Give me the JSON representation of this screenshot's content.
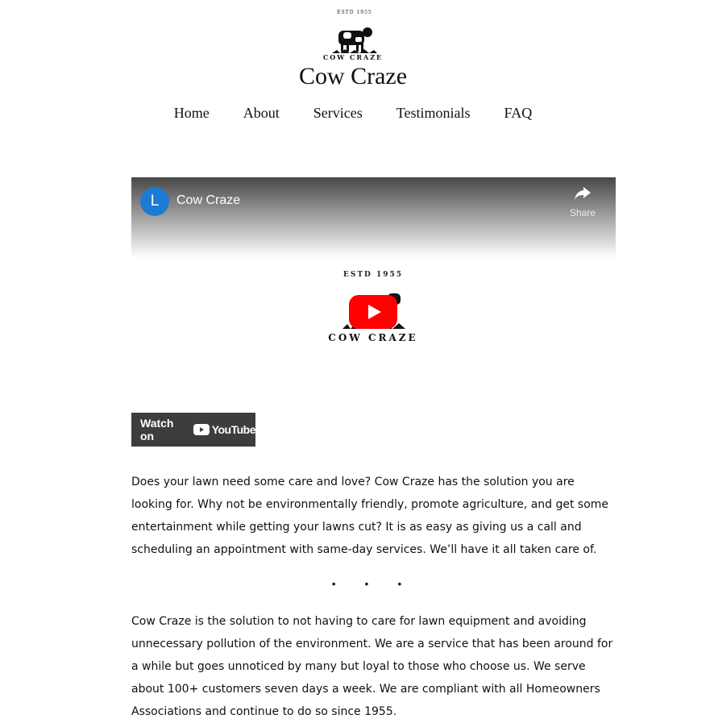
{
  "header": {
    "logo": {
      "estd": "ESTD 1955",
      "word": "COW CRAZE"
    },
    "site_title": "Cow Craze"
  },
  "nav": {
    "items": [
      {
        "label": "Home"
      },
      {
        "label": "About"
      },
      {
        "label": "Services"
      },
      {
        "label": "Testimonials"
      },
      {
        "label": "FAQ"
      }
    ]
  },
  "video": {
    "channel_initial": "L",
    "title": "Cow Craze",
    "share_label": "Share",
    "thumbnail": {
      "estd": "ESTD 1955",
      "word": "COW CRAZE"
    },
    "watch_on_label": "Watch on",
    "youtube_label": "YouTube",
    "colors": {
      "avatar": "#1e7bd4",
      "play": "#ff0000",
      "watch_bg": "#3d3d3d"
    }
  },
  "content": {
    "paragraph1": "Does your lawn need some care and love? Cow Craze has the solution you are looking for. Why not be environmentally friendly, promote agriculture, and get some entertainment while getting your lawns cut? It is as easy as giving us a call and scheduling an appointment with same-day services. We’ll have it all taken care of.",
    "separator": "• • •",
    "paragraph2": "Cow Craze is the solution to not having to care for lawn equipment and avoiding unnecessary pollution of the environment. We are a service that has been around for a while but goes unnoticed by many but loyal to those who choose us. We serve about 100+ customers seven days a week. We are compliant with all Homeowners Associations and continue to do so since 1955."
  }
}
